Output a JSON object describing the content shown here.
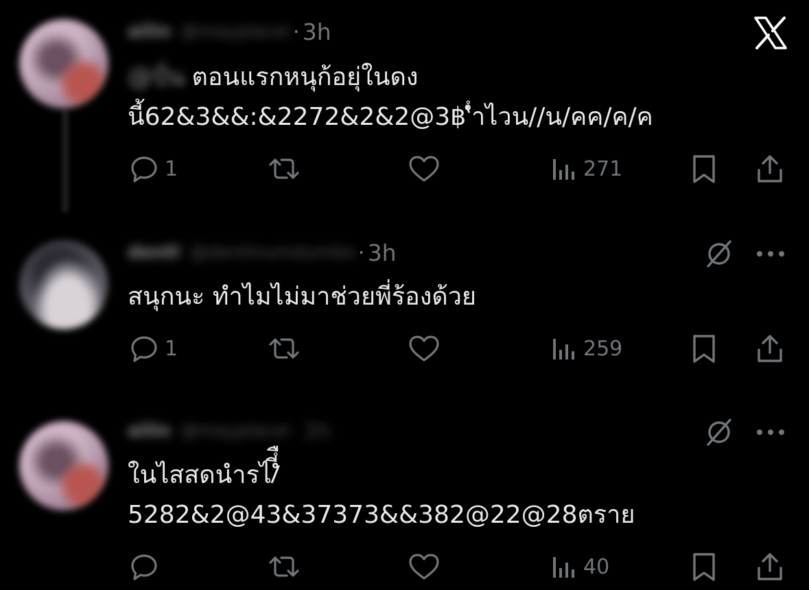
{
  "close_icon": "x-icon",
  "tweets": [
    {
      "name": "ailin",
      "handle": "@mayplacei",
      "time": "3h",
      "mention": "@ปั่น",
      "lines": [
        "ตอนแรกหนุก้อยุ่ในดง",
        "นี้62&3&&:&2272&2&2@3฿‘ํำไวน//น/คค/ค/ค"
      ],
      "replies": "1",
      "views": "271"
    },
    {
      "name": "dentl",
      "handle": "@dentlnumdumbo",
      "time": "3h",
      "lines": [
        "สนุกนะ ทำไมไม่มาช่วยพี่ร้องด้วย"
      ],
      "replies": "1",
      "views": "259"
    },
    {
      "name": "ailin",
      "handle": "@mayplacei",
      "time": "3h",
      "lines": [
        "ในไสสดนำรไ/ํีํื",
        "5282&2@43&37373&&382@22@28ตราย"
      ],
      "replies": "",
      "views": "40"
    }
  ],
  "colors": {
    "background": "#000000",
    "text": "#e7e9ea",
    "muted": "#71767b"
  }
}
